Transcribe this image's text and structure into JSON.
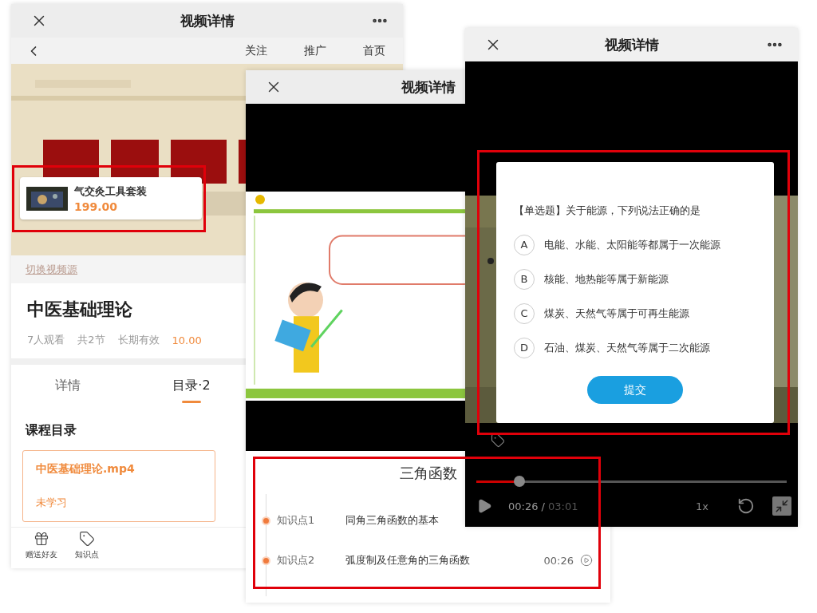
{
  "left_phone": {
    "title": "视频详情",
    "nav": [
      "关注",
      "推广",
      "首页"
    ],
    "product": {
      "name": "气交灸工具套装",
      "price": "199.00"
    },
    "switch_source": "切换视频源",
    "course_title": "中医基础理论",
    "meta": [
      "7人观看",
      "共2节",
      "长期有效"
    ],
    "price": "10.00",
    "tabs": [
      {
        "label": "详情",
        "selected": false
      },
      {
        "label": "目录·2",
        "selected": true
      }
    ],
    "section_title": "课程目录",
    "lessons": [
      {
        "title": "中医基础理论.mp4",
        "status": "未学习"
      }
    ],
    "footer": [
      {
        "kind": "gift",
        "label": "赠送好友"
      },
      {
        "kind": "tag",
        "label": "知识点"
      }
    ]
  },
  "middle_phone": {
    "title": "视频详情",
    "panel_title": "三角函数",
    "points": [
      {
        "label": "知识点1",
        "text": "同角三角函数的基本"
      },
      {
        "label": "知识点2",
        "text": "弧度制及任意角的三角函数",
        "time": "00:26"
      }
    ]
  },
  "right_phone": {
    "title": "视频详情",
    "question": "【单选题】关于能源，下列说法正确的是",
    "options": [
      {
        "letter": "A",
        "text": "电能、水能、太阳能等都属于一次能源"
      },
      {
        "letter": "B",
        "text": "核能、地热能等属于新能源"
      },
      {
        "letter": "C",
        "text": "煤炭、天然气等属于可再生能源"
      },
      {
        "letter": "D",
        "text": "石油、煤炭、天然气等属于二次能源"
      }
    ],
    "submit": "提交",
    "progress": {
      "level": 0.14
    },
    "elapsed": "00:26 /",
    "duration": "03:01",
    "speed": "1x"
  }
}
